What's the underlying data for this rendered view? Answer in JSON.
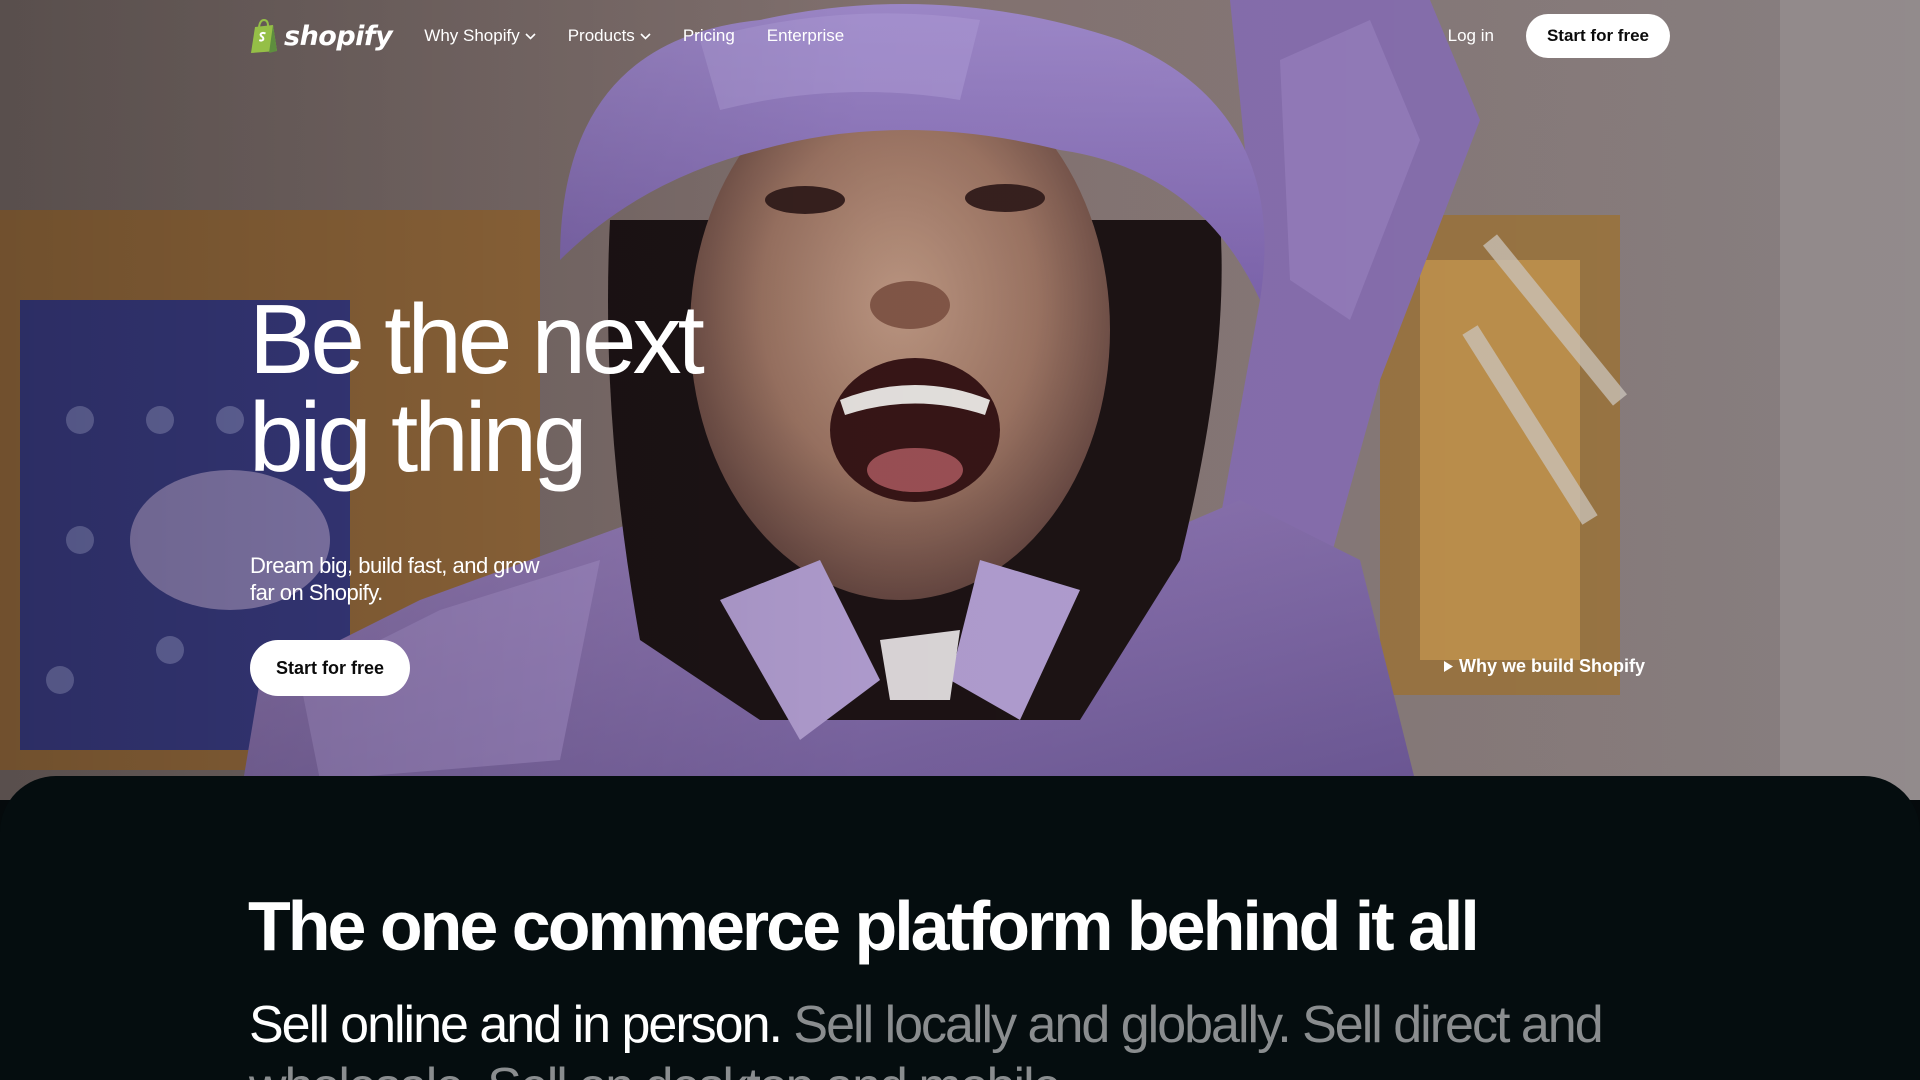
{
  "nav": {
    "logo_text": "shopify",
    "links": [
      {
        "label": "Why Shopify",
        "has_dropdown": true
      },
      {
        "label": "Products",
        "has_dropdown": true
      },
      {
        "label": "Pricing",
        "has_dropdown": false
      },
      {
        "label": "Enterprise",
        "has_dropdown": false
      }
    ],
    "login_label": "Log in",
    "cta_label": "Start for free"
  },
  "hero": {
    "headline_line1": "Be the next",
    "headline_line2": "big thing",
    "subhead": "Dream big, build fast, and grow far on Shopify.",
    "cta_label": "Start for free",
    "video_link_label": "Why we build Shopify"
  },
  "platform": {
    "title": "The one commerce platform behind it all",
    "line_strong": "Sell online and in person.",
    "line_dim_1": "Sell locally and globally. Sell direct and",
    "line_dim_2": "wholesale. Sell on desktop and mobile."
  },
  "colors": {
    "brand_green": "#95bf47",
    "dark_section": "#050d0f",
    "hat_purple": "#9a84c9",
    "dim_text": "#8a8d8f"
  },
  "icons": {
    "logo": "shopping-bag-icon",
    "dropdown": "chevron-down-icon",
    "video": "play-icon"
  }
}
